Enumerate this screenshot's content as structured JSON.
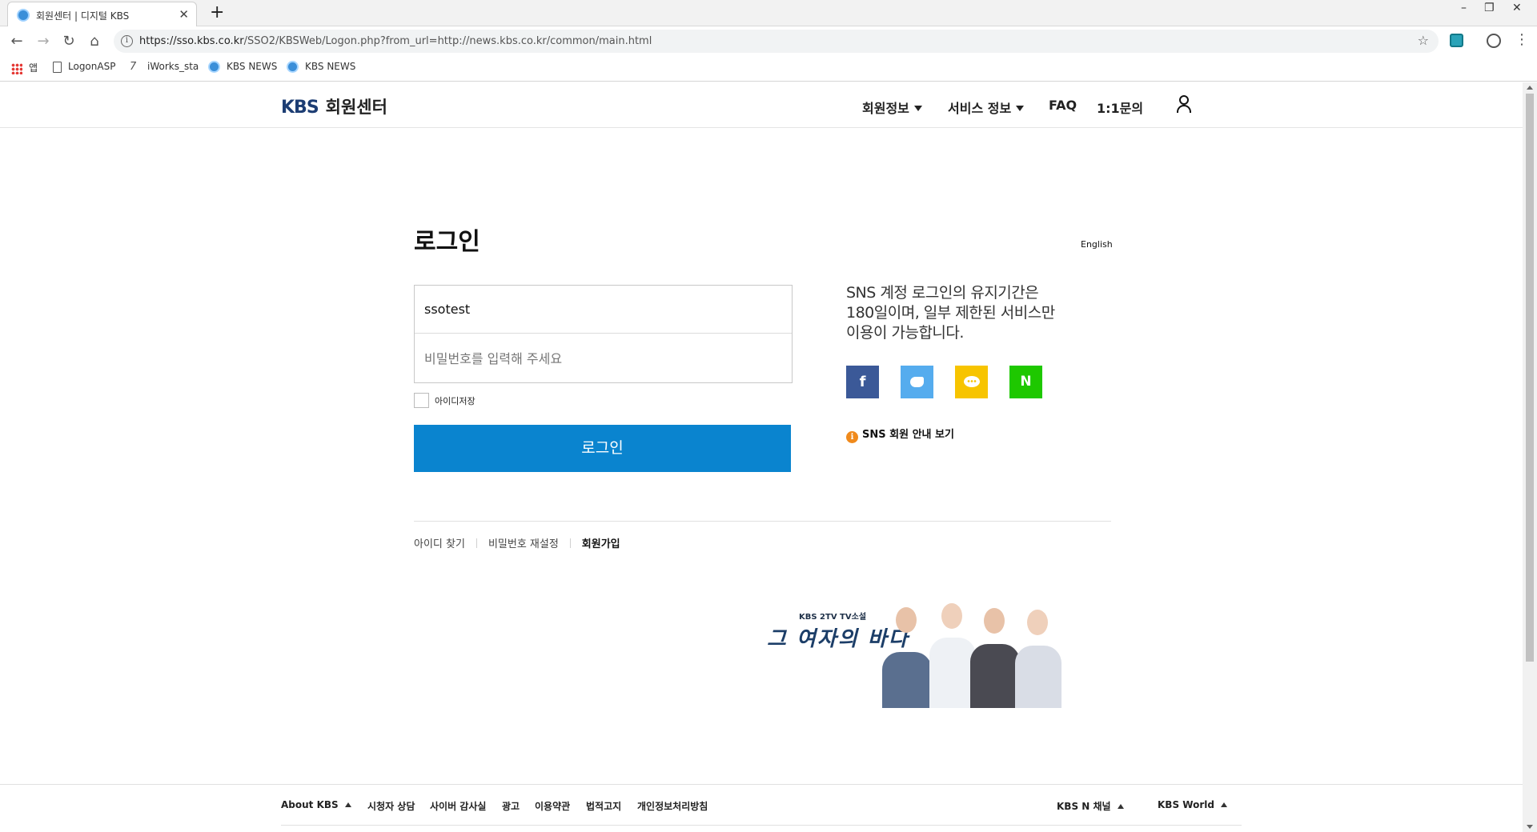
{
  "browser": {
    "tab_title": "회원센터 | 디지털 KBS",
    "url_host": "https://sso.kbs.co.kr",
    "url_path": "/SSO2/KBSWeb/Logon.php?from_url=http://news.kbs.co.kr/common/main.html",
    "bookmarks": [
      "앱",
      "LogonASP",
      "iWorks_sta",
      "KBS NEWS",
      "KBS NEWS"
    ]
  },
  "header": {
    "logo_kbs": "KBS",
    "logo_text": "회원센터",
    "nav": [
      "회원정보",
      "서비스 정보",
      "FAQ",
      "1:1문의"
    ]
  },
  "login": {
    "title": "로그인",
    "english": "English",
    "id_value": "ssotest",
    "pw_placeholder": "비밀번호를 입력해 주세요",
    "save_id": "아이디저장",
    "button": "로그인"
  },
  "sns": {
    "info_lines": [
      "SNS 계정 로그인의 유지기간은",
      "180일이며, 일부 제한된 서비스만",
      "이용이 가능합니다."
    ],
    "facebook": "f",
    "naver": "N",
    "guide": "SNS 회원 안내 보기"
  },
  "links": {
    "find_id": "아이디 찾기",
    "reset_pw": "비밀번호 재설정",
    "signup": "회원가입"
  },
  "banner": {
    "tag": "KBS 2TV TV소설",
    "title": "그 여자의 바다"
  },
  "footer": {
    "about": "About KBS",
    "links": [
      "시청자 상담",
      "사이버 감사실",
      "광고",
      "이용약관",
      "법적고지",
      "개인정보처리방침"
    ],
    "channel": "KBS N 채널",
    "world": "KBS World"
  },
  "colors": {
    "login_button": "#0a84cf",
    "facebook": "#3b5998",
    "twitter": "#55acee",
    "kakao": "#f7c400",
    "naver": "#1ec800",
    "info_icon": "#f08a1c"
  }
}
